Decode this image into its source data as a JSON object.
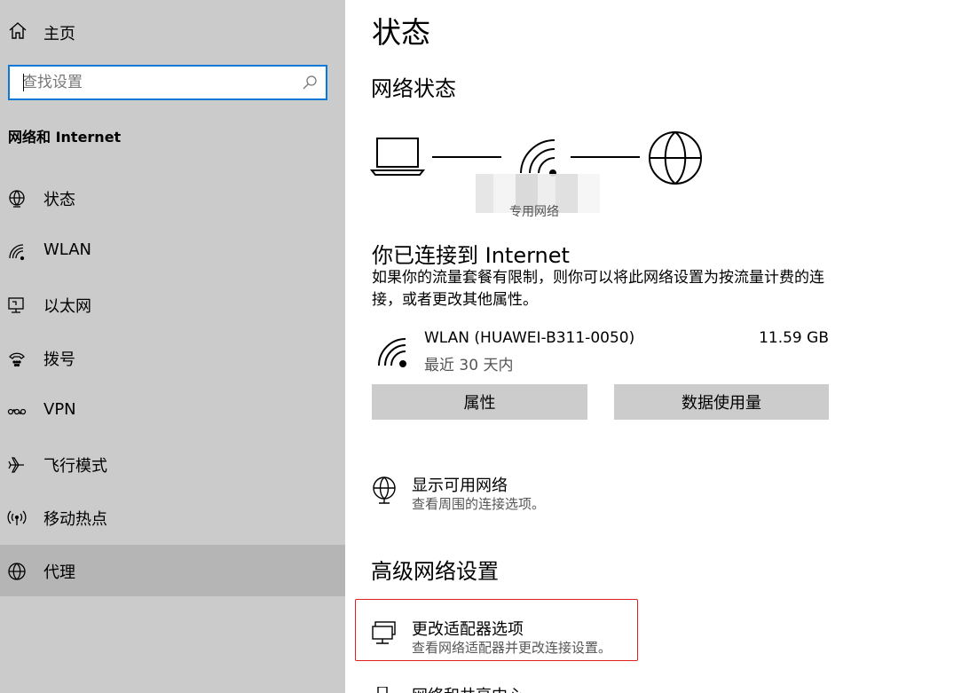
{
  "sidebar": {
    "home_label": "主页",
    "search_placeholder": "查找设置",
    "section_title": "网络和 Internet",
    "items": [
      {
        "label": "状态",
        "icon": "status-icon"
      },
      {
        "label": "WLAN",
        "icon": "wifi-icon"
      },
      {
        "label": "以太网",
        "icon": "ethernet-icon"
      },
      {
        "label": "拨号",
        "icon": "dialup-icon"
      },
      {
        "label": "VPN",
        "icon": "vpn-icon"
      },
      {
        "label": "飞行模式",
        "icon": "airplane-icon"
      },
      {
        "label": "移动热点",
        "icon": "hotspot-icon"
      },
      {
        "label": "代理",
        "icon": "globe-icon",
        "active": true
      }
    ]
  },
  "main": {
    "page_title": "状态",
    "network_status_title": "网络状态",
    "network_type_label": "专用网络",
    "connected_title": "你已连接到 Internet",
    "connected_desc": "如果你的流量套餐有限制，则你可以将此网络设置为按流量计费的连接，或者更改其他属性。",
    "network": {
      "name": "WLAN (HUAWEI-B311-0050)",
      "period": "最近 30 天内",
      "usage": "11.59 GB"
    },
    "buttons": {
      "properties": "属性",
      "data_usage": "数据使用量"
    },
    "show_networks": {
      "title": "显示可用网络",
      "subtitle": "查看周围的连接选项。"
    },
    "advanced_title": "高级网络设置",
    "change_adapter": {
      "title": "更改适配器选项",
      "subtitle": "查看网络适配器并更改连接设置。"
    },
    "sharing_center": {
      "title": "网络和共享中心"
    }
  },
  "colors": {
    "sidebar_bg": "#cbcbcb",
    "active_item_bg": "#b5b5b5",
    "search_border": "#0a78d7",
    "button_bg": "#cccccc",
    "highlight_border": "#e02020"
  }
}
